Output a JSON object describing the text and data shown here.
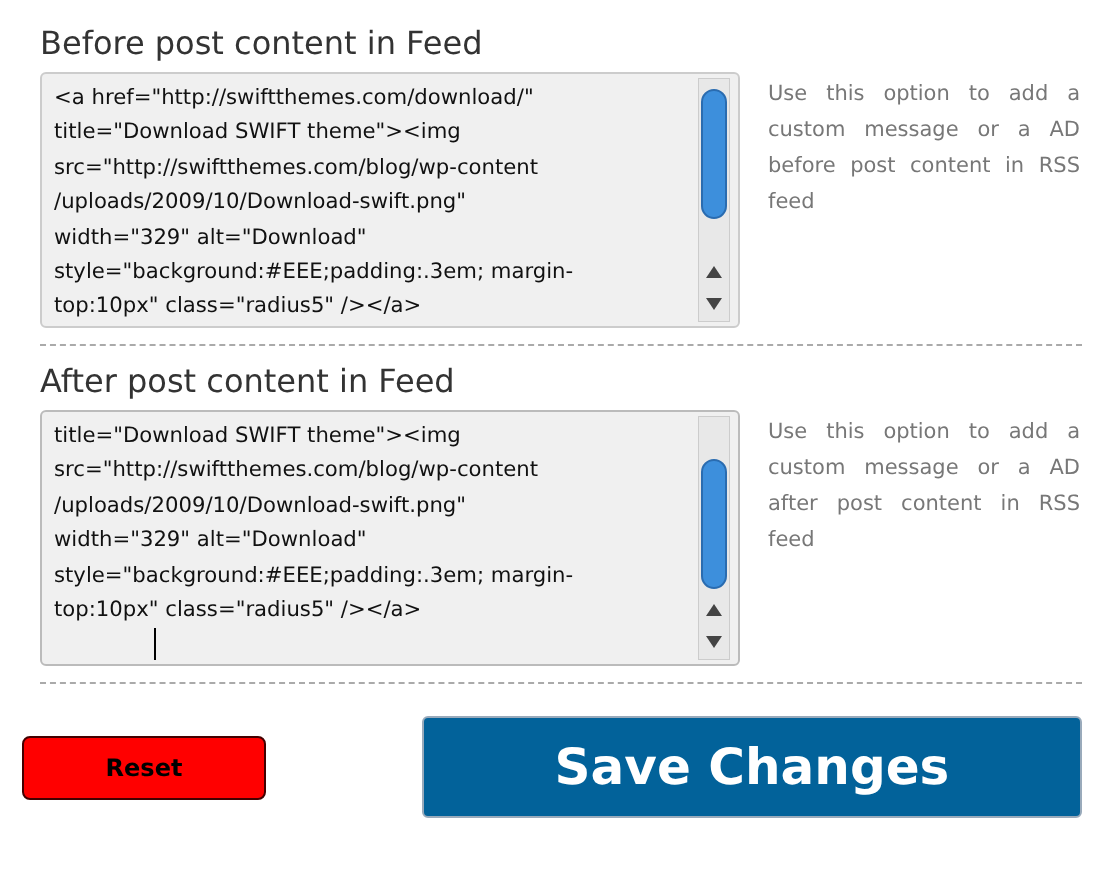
{
  "sections": [
    {
      "title": "Before post content in Feed",
      "lines": [
        "<a href=\"http://swiftthemes.com/download/\"",
        "title=\"Download SWIFT theme\"><img",
        "src=\"http://swiftthemes.com/blog/wp-content",
        "/uploads/2009/10/Download-swift.png\"",
        "width=\"329\" alt=\"Download\"",
        "style=\"background:#EEE;padding:.3em; margin-",
        "top:10px\" class=\"radius5\" /></a>"
      ],
      "help": "Use this option to add a custom message or a AD before post content in RSS feed",
      "focused": false
    },
    {
      "title": "After post content in Feed",
      "lines": [
        "title=\"Download SWIFT theme\"><img",
        "src=\"http://swiftthemes.com/blog/wp-content",
        "/uploads/2009/10/Download-swift.png\"",
        "width=\"329\" alt=\"Download\"",
        "style=\"background:#EEE;padding:.3em; margin-",
        "top:10px\" class=\"radius5\" /></a>"
      ],
      "help": "Use this option to add a custom message or a AD after post content in RSS feed",
      "focused": true
    }
  ],
  "reset": "Reset",
  "save": "Save Changes"
}
